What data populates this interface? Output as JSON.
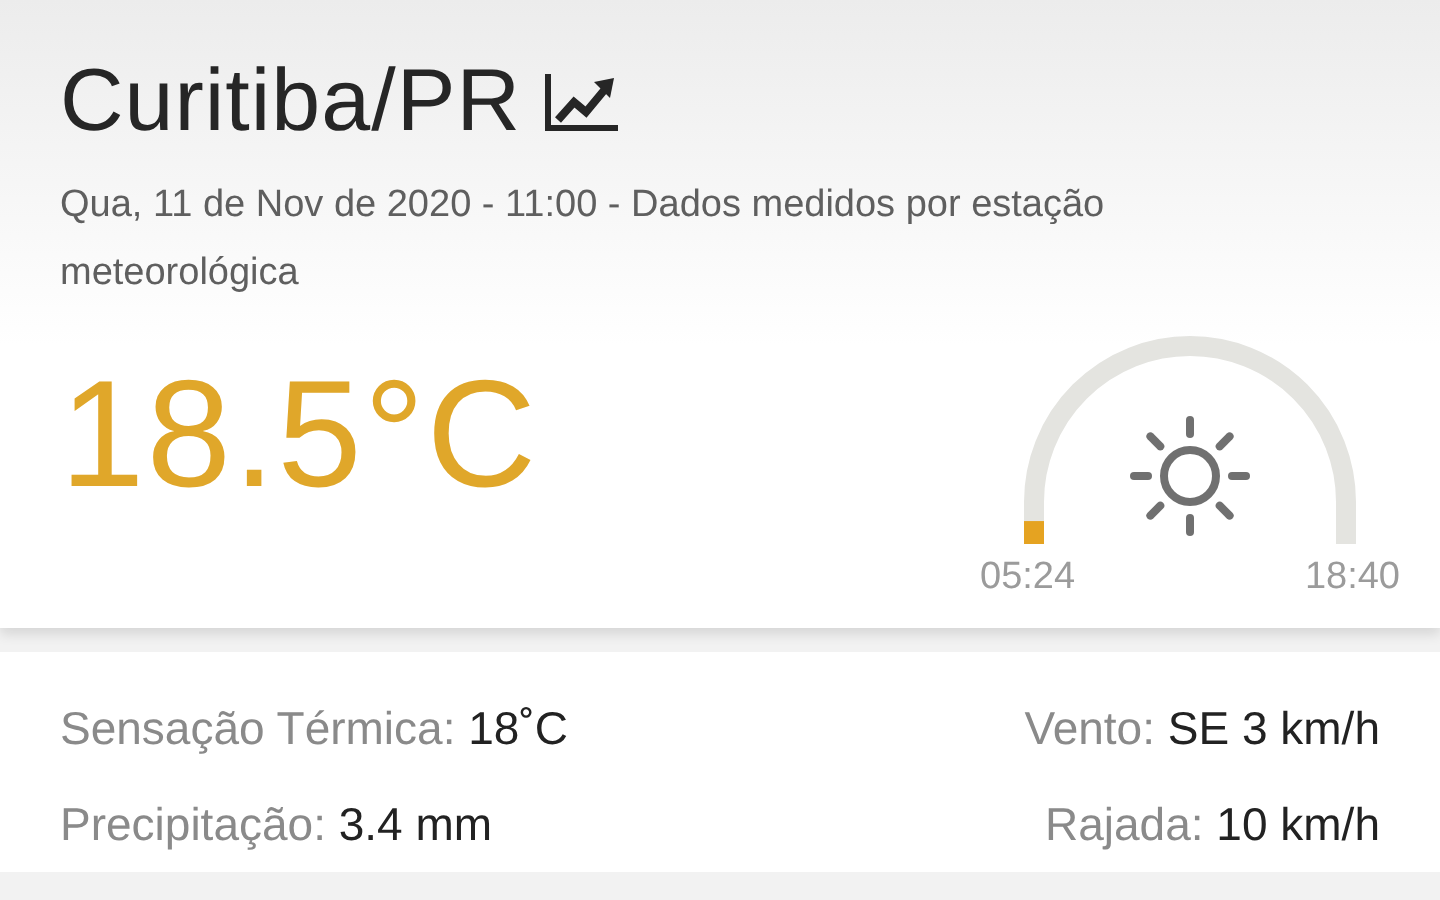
{
  "location": {
    "city": "Curitiba/PR"
  },
  "subtitle": "Qua, 11 de Nov de 2020 - 11:00 - Dados medidos por estação meteorológica",
  "temperature": "18.5°C",
  "daylight": {
    "sunrise": "05:24",
    "sunset": "18:40"
  },
  "details": [
    {
      "label": "Sensação Térmica:",
      "value": "18˚C"
    },
    {
      "label": "Vento:",
      "value": "SE 3 km/h"
    },
    {
      "label": "Precipitação:",
      "value": "3.4 mm"
    },
    {
      "label": "Rajada:",
      "value": "10 km/h"
    }
  ]
}
